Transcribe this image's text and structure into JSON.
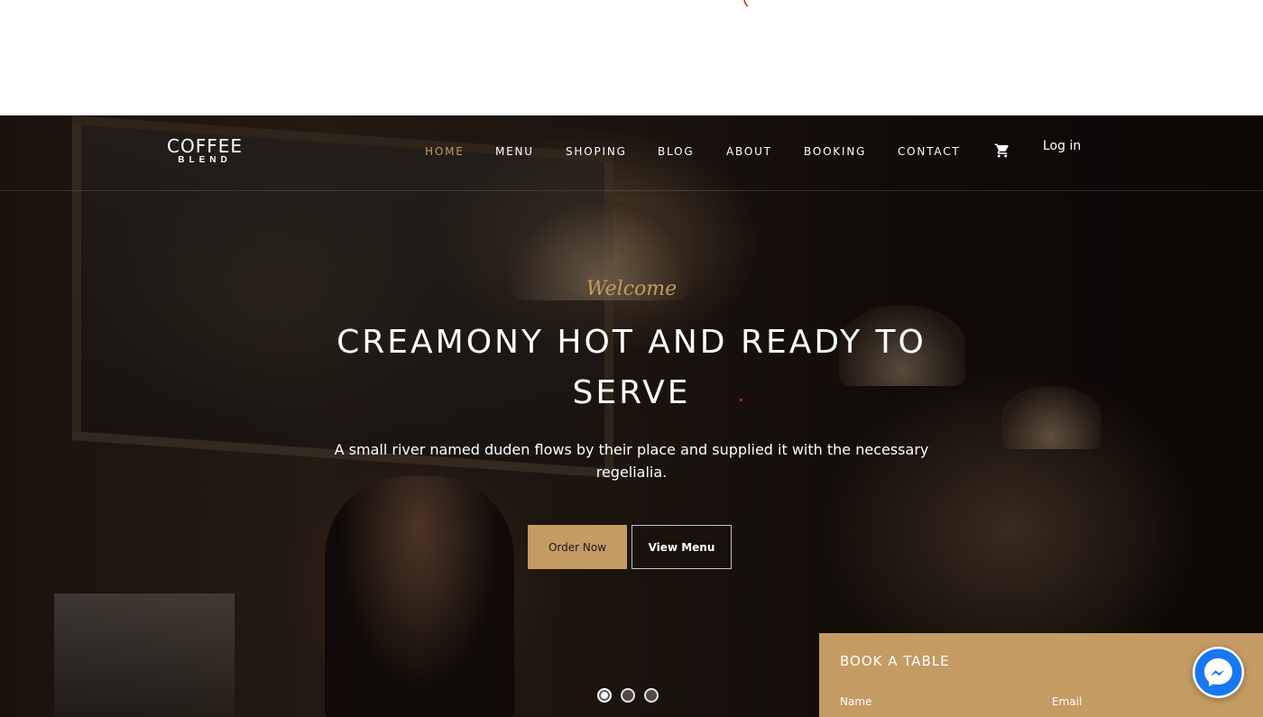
{
  "brand": {
    "line1": "COFFEE",
    "line2": "BLEND"
  },
  "nav": {
    "items": [
      {
        "label": "HOME",
        "active": true
      },
      {
        "label": "MENU",
        "active": false
      },
      {
        "label": "SHOPING",
        "active": false
      },
      {
        "label": "BLOG",
        "active": false
      },
      {
        "label": "ABOUT",
        "active": false
      },
      {
        "label": "BOOKING",
        "active": false
      },
      {
        "label": "CONTACT",
        "active": false
      }
    ],
    "cart_icon": "shopping-cart-icon",
    "login_label": "Log in"
  },
  "hero": {
    "welcome": "Welcome",
    "headline": "CREAMONY HOT AND READY TO SERVE",
    "subtext": "A small river named duden flows by their place and supplied it with the necessary regelialia.",
    "primary_button": "Order Now",
    "secondary_button": "View Menu",
    "slide_indicator": {
      "count": 3,
      "active": 1
    }
  },
  "book_table": {
    "title": "BOOK A TABLE",
    "fields": [
      "Name",
      "Email"
    ]
  },
  "colors": {
    "accent": "#c49b63",
    "messenger_blue": "#1877f2"
  },
  "chat_widget": {
    "icon": "messenger-icon"
  }
}
